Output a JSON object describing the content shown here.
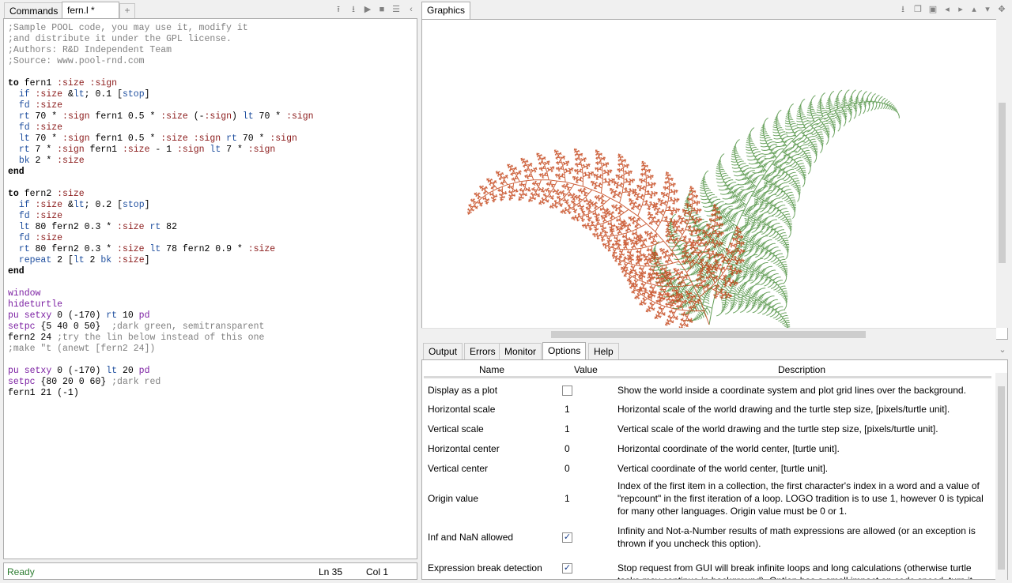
{
  "editor": {
    "tabs": [
      "Commands",
      "fern.l *"
    ],
    "add_tab": "+",
    "code": [
      ";Sample POOL code, you may use it, modify it",
      ";and distribute it under the GPL license.",
      ";Authors: R&D Independent Team",
      ";Source: www.pool-rnd.com",
      "",
      "to fern1 :size :sign",
      "  if :size < 0.1 [stop]",
      "  fd :size",
      "  rt 70 * :sign fern1 0.5 * :size (-:sign) lt 70 * :sign",
      "  fd :size",
      "  lt 70 * :sign fern1 0.5 * :size :sign rt 70 * :sign",
      "  rt 7 * :sign fern1 :size - 1 :sign lt 7 * :sign",
      "  bk 2 * :size",
      "end",
      "",
      "to fern2 :size",
      "  if :size < 0.2 [stop]",
      "  fd :size",
      "  lt 80 fern2 0.3 * :size rt 82",
      "  fd :size",
      "  rt 80 fern2 0.3 * :size lt 78 fern2 0.9 * :size",
      "  repeat 2 [lt 2 bk :size]",
      "end",
      "",
      "window",
      "hideturtle",
      "pu setxy 0 (-170) rt 10 pd",
      "setpc {5 40 0 50}  ;dark green, semitransparent",
      "fern2 24 ;try the lin below instead of this one",
      ";make \"t (anewt [fern2 24])",
      "",
      "pu setxy 0 (-170) lt 20 pd",
      "setpc {80 20 0 60} ;dark red",
      "fern1 21 (-1)"
    ]
  },
  "status": {
    "ready": "Ready",
    "line": "Ln 35",
    "col": "Col 1"
  },
  "graphics": {
    "tab": "Graphics",
    "colors": {
      "red_fern": "#c0390b",
      "green_fern": "#2f7d1f"
    }
  },
  "bottom_tabs": [
    "Output",
    "Errors",
    "Monitor",
    "Options",
    "Help"
  ],
  "options": {
    "headers": {
      "name": "Name",
      "value": "Value",
      "description": "Description"
    },
    "rows": [
      {
        "name": "Display as a plot",
        "value": "",
        "checkbox": true,
        "checked": false,
        "desc": "Show the world inside a coordinate system and plot grid lines over the background."
      },
      {
        "name": "Horizontal scale",
        "value": "1",
        "checkbox": false,
        "desc": "Horizontal scale of the world drawing and the turtle step size, [pixels/turtle unit]."
      },
      {
        "name": "Vertical scale",
        "value": "1",
        "checkbox": false,
        "desc": "Vertical scale of the world drawing and the turtle step size, [pixels/turtle unit]."
      },
      {
        "name": "Horizontal center",
        "value": "0",
        "checkbox": false,
        "desc": "Horizontal coordinate of the world center, [turtle unit]."
      },
      {
        "name": "Vertical center",
        "value": "0",
        "checkbox": false,
        "desc": "Vertical coordinate of the world center, [turtle unit]."
      },
      {
        "name": "Origin value",
        "value": "1",
        "checkbox": false,
        "desc": "Index of the first item in a collection, the first character's index in a word and a value of \"repcount\" in the first iteration of a loop. LOGO tradition is to use 1, however 0 is typical for many other languages. Origin value must be 0 or 1."
      },
      {
        "name": "Inf and NaN allowed",
        "value": "",
        "checkbox": true,
        "checked": true,
        "desc": "Infinity and Not-a-Number results of math expressions are allowed (or an exception is thrown if you uncheck this option)."
      },
      {
        "name": "Expression break detection",
        "value": "",
        "checkbox": true,
        "checked": true,
        "desc": "Stop request from GUI will break infinite loops and long calculations (otherwise turtle tasks may continue in background). Option has a small impact on code speed, turn it"
      }
    ]
  }
}
